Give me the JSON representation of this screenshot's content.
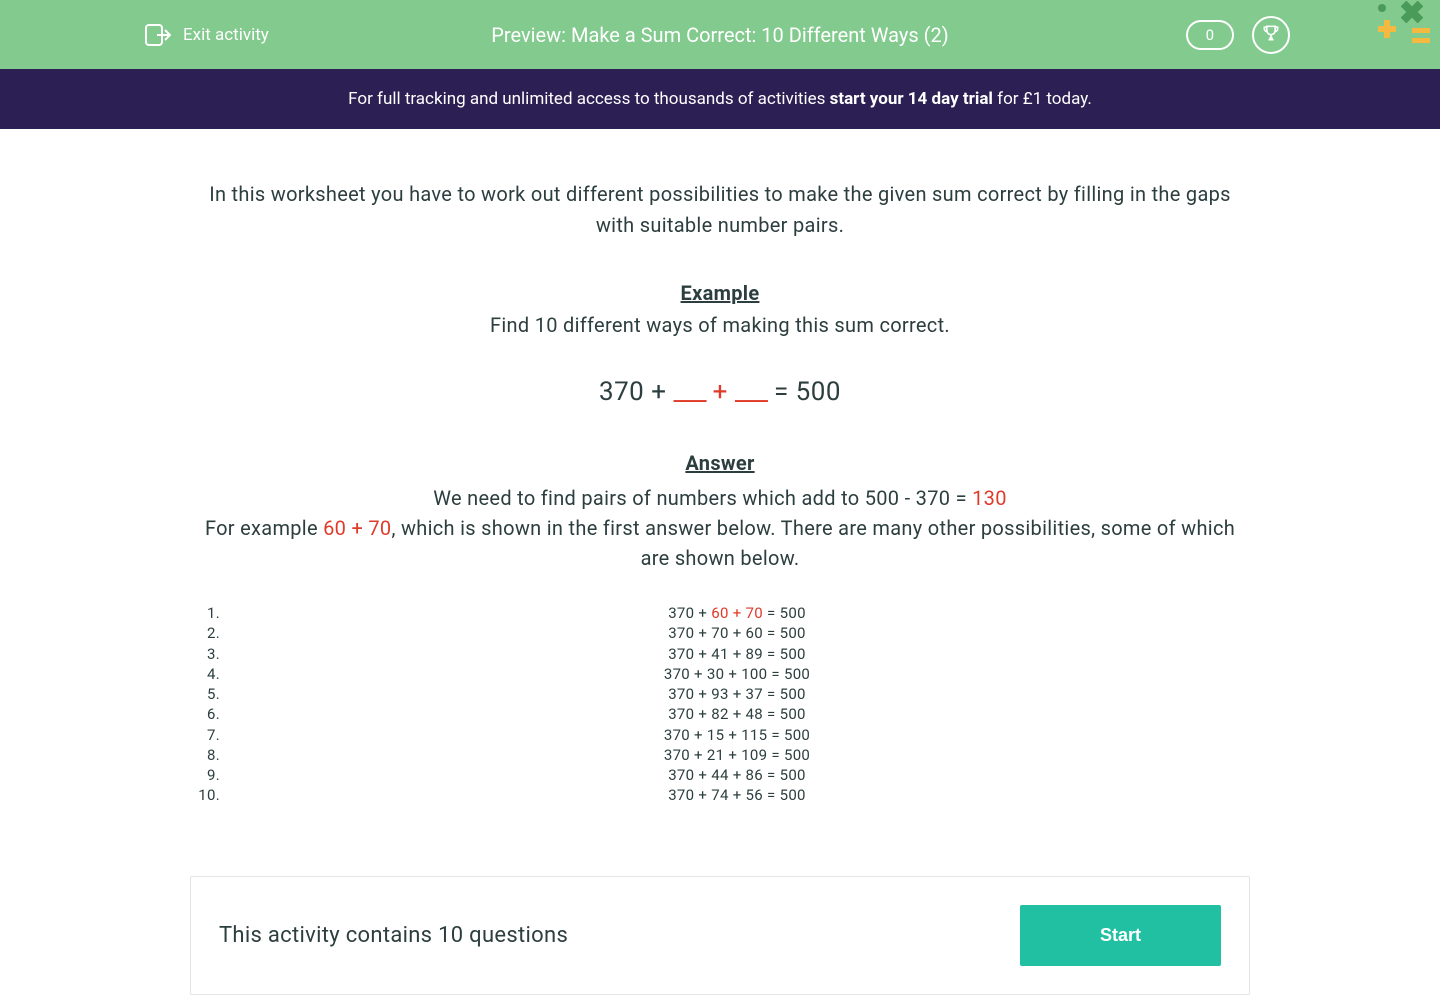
{
  "header": {
    "exit_label": "Exit activity",
    "title": "Preview: Make a Sum Correct: 10 Different Ways (2)",
    "score": "0"
  },
  "banner": {
    "prefix": "For full tracking and unlimited access to thousands of activities ",
    "bold": "start your 14 day trial",
    "suffix": " for £1 today."
  },
  "content": {
    "intro": "In this worksheet you have to work out different possibilities to make the given sum correct by filling in the gaps with suitable number pairs.",
    "example_label": "Example",
    "example_desc": "Find 10 different ways of making this sum correct.",
    "equation": {
      "lhs": "370 + ",
      "blank1": "___",
      "plus": " + ",
      "blank2": "___",
      "rhs": " = 500"
    },
    "answer_label": "Answer",
    "answer_line1_prefix": "We need to find pairs of numbers which add to 500 - 370 = ",
    "answer_line1_value": "130",
    "answer_line2_prefix": "For example ",
    "answer_line2_highlight": "60 + 70",
    "answer_line2_suffix": ", which is shown in the first answer below. There are many other possibilities, some of which are shown below.",
    "rows": [
      {
        "pre": "370 + ",
        "hl": "60 + 70",
        "post": " = 500"
      },
      {
        "pre": "370 + 70 + 60 = 500",
        "hl": "",
        "post": ""
      },
      {
        "pre": "370 + 41 + 89 = 500",
        "hl": "",
        "post": ""
      },
      {
        "pre": "370 + 30 + 100 = 500",
        "hl": "",
        "post": ""
      },
      {
        "pre": "370 + 93 + 37 = 500",
        "hl": "",
        "post": ""
      },
      {
        "pre": "370 + 82 + 48 = 500",
        "hl": "",
        "post": ""
      },
      {
        "pre": "370 + 15 + 115 = 500",
        "hl": "",
        "post": ""
      },
      {
        "pre": "370 + 21 + 109 = 500",
        "hl": "",
        "post": ""
      },
      {
        "pre": "370 + 44 + 86 = 500",
        "hl": "",
        "post": ""
      },
      {
        "pre": "370 + 74 + 56 = 500",
        "hl": "",
        "post": ""
      }
    ]
  },
  "footer": {
    "info": "This activity contains 10 questions",
    "start_label": "Start"
  }
}
